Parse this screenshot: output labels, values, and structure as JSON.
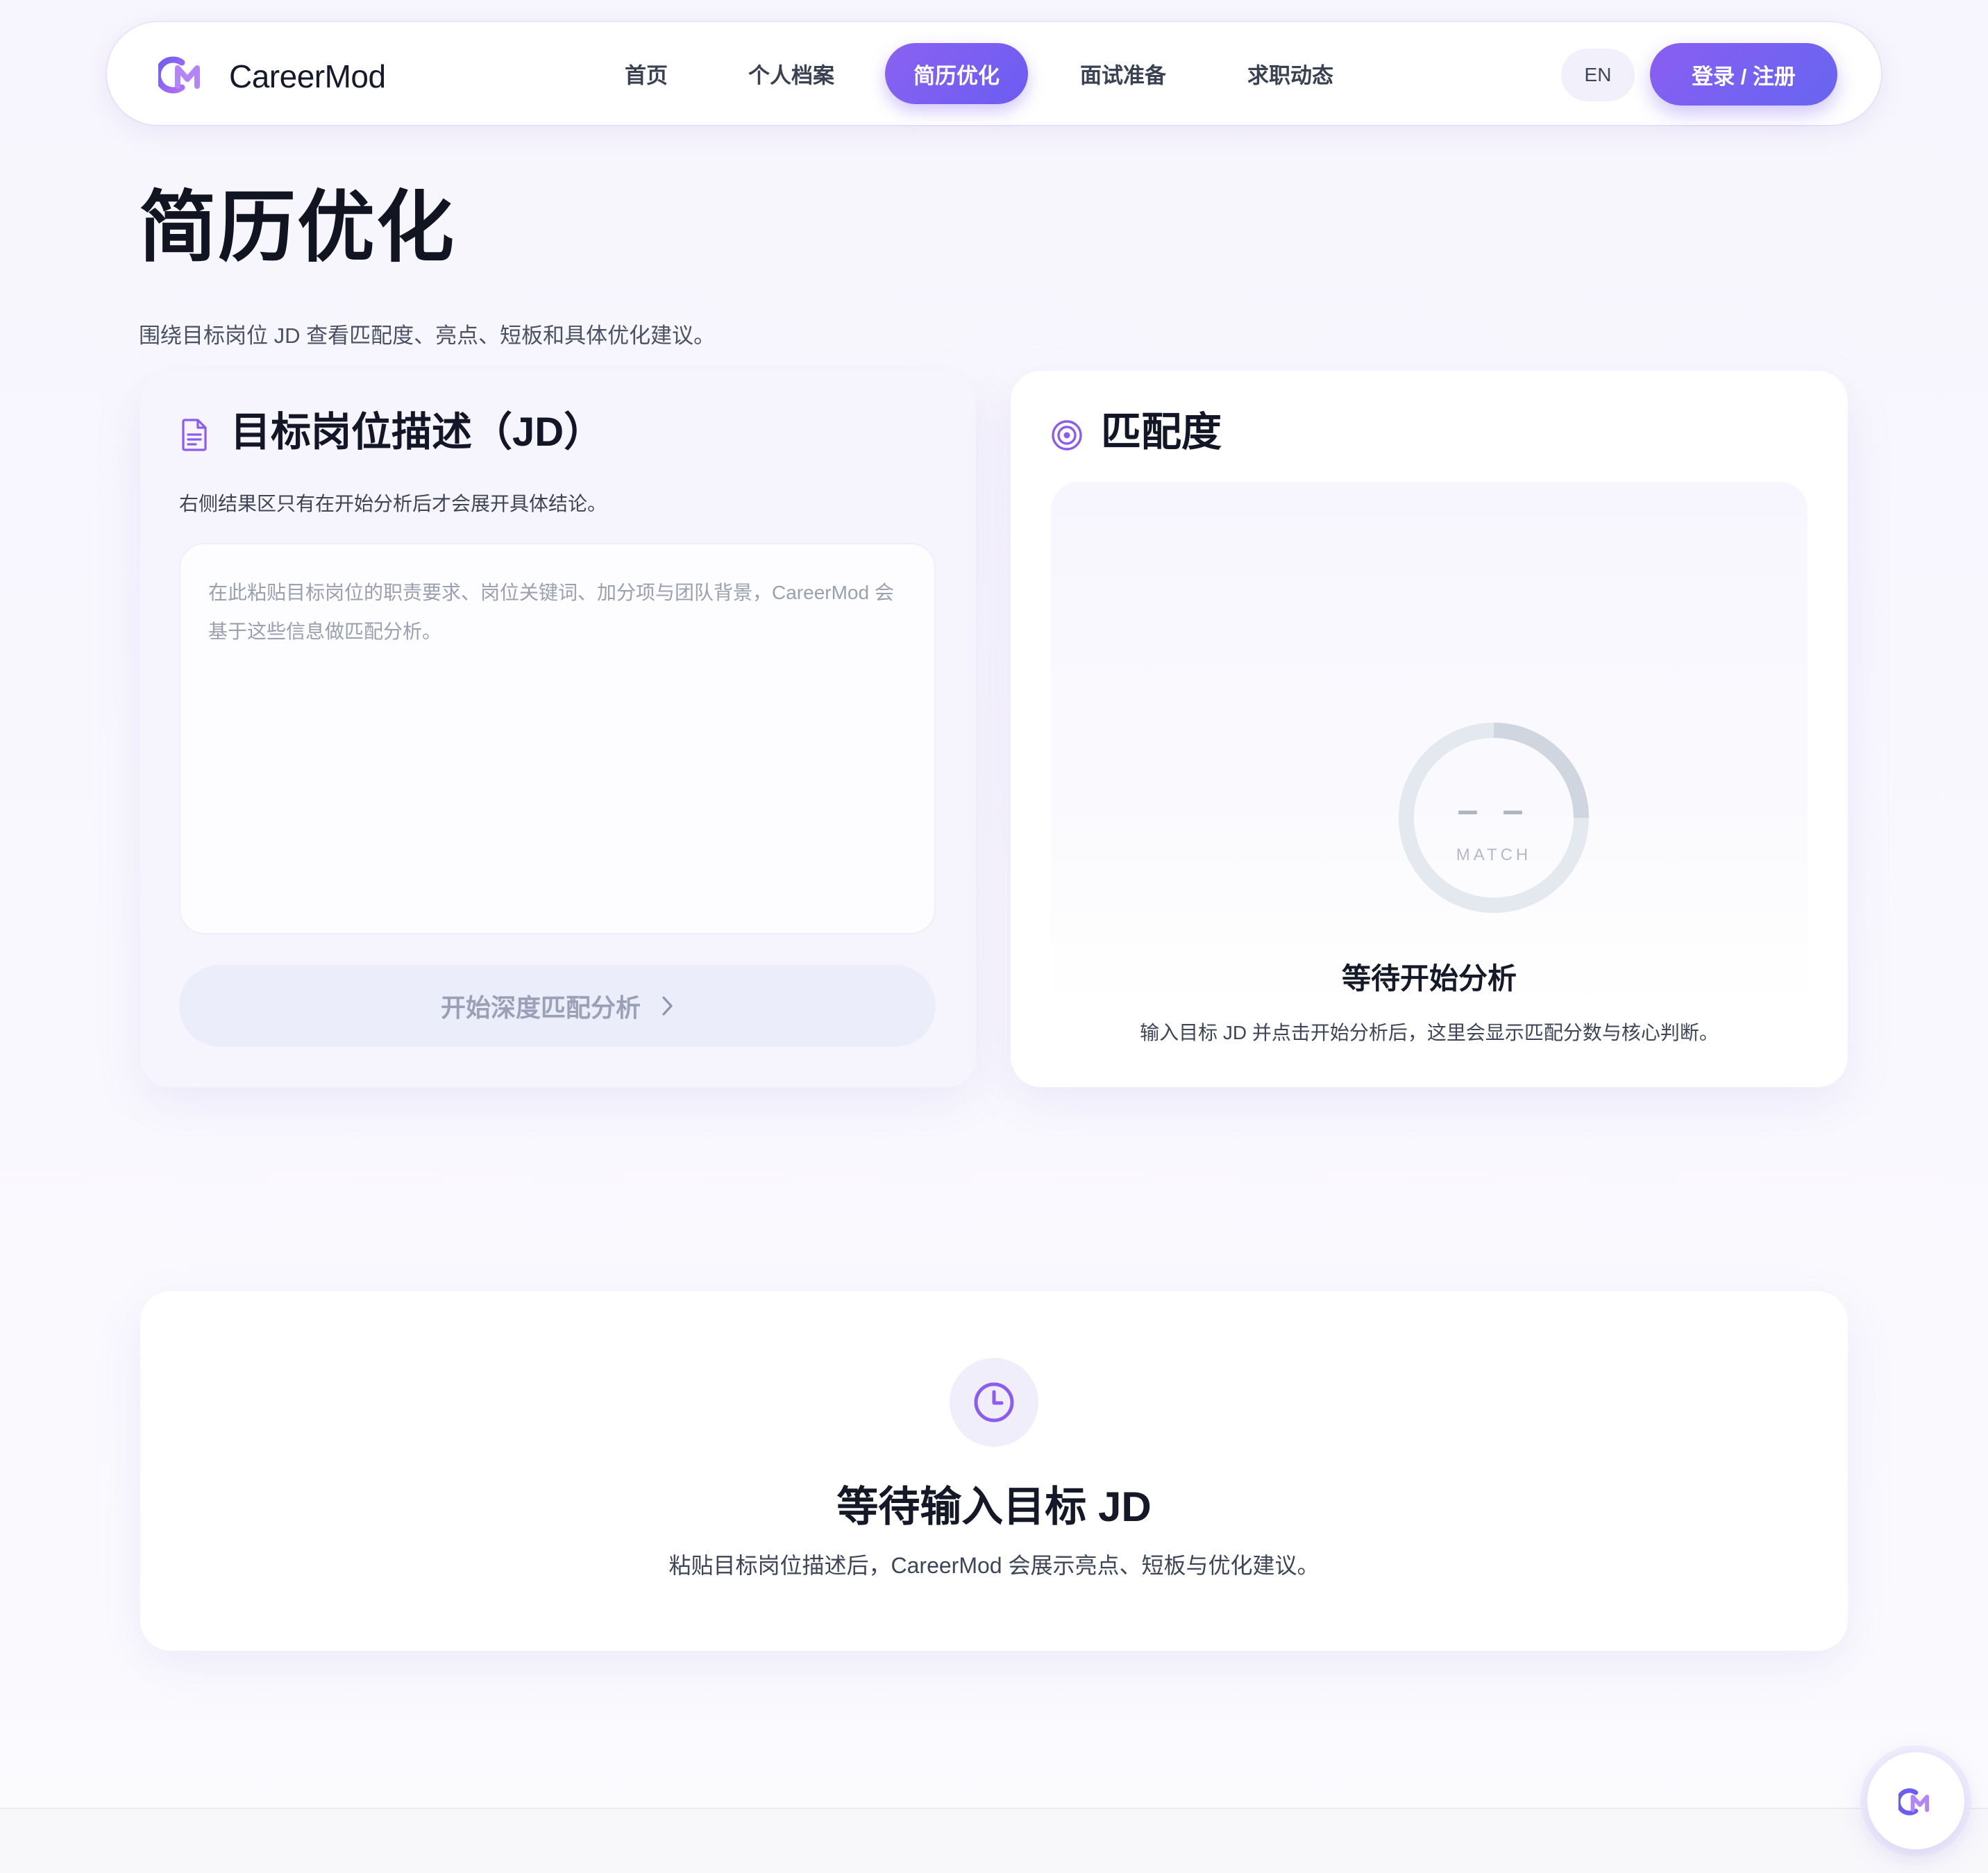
{
  "nav": {
    "brand": "CareerMod",
    "items": [
      "首页",
      "个人档案",
      "简历优化",
      "面试准备",
      "求职动态"
    ],
    "active": "简历优化",
    "lang": "EN",
    "login": "登录 / 注册"
  },
  "header": {
    "title": "简历优化",
    "subtitle": "围绕目标岗位 JD 查看匹配度、亮点、短板和具体优化建议。"
  },
  "jd_card": {
    "title": "目标岗位描述（JD）",
    "hint": "右侧结果区只有在开始分析后才会展开具体结论。",
    "placeholder": "在此粘贴目标岗位的职责要求、岗位关键词、加分项与团队背景，CareerMod 会基于这些信息做匹配分析。",
    "button": "开始深度匹配分析"
  },
  "match_card": {
    "title": "匹配度",
    "score": "– –",
    "score_label": "MATCH",
    "wait_title": "等待开始分析",
    "wait_desc": "输入目标 JD 并点击开始分析后，这里会显示匹配分数与核心判断。"
  },
  "bottom_card": {
    "title": "等待输入目标 JD",
    "desc": "粘贴目标岗位描述后，CareerMod 会展示亮点、短板与优化建议。"
  },
  "colors": {
    "accent": "#7c5cf1",
    "accent_gradient_start": "#8a5ef2",
    "accent_gradient_end": "#6665f1",
    "ring_track": "#e4e9ef",
    "ring_arc": "#cfd6e0"
  }
}
